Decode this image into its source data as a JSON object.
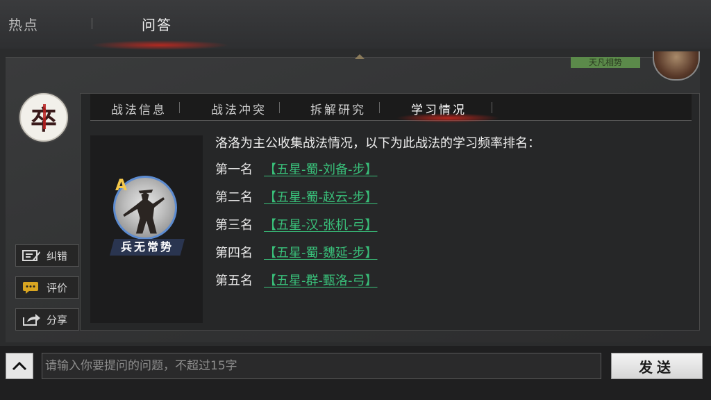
{
  "top_tabs": [
    "热点",
    "问答"
  ],
  "user": {
    "badge": "天凡相势"
  },
  "bot": {
    "avatar_char": "卒"
  },
  "side_buttons": [
    {
      "label": "纠错",
      "icon": "edit-icon"
    },
    {
      "label": "评价",
      "icon": "comment-icon"
    },
    {
      "label": "分享",
      "icon": "share-icon"
    }
  ],
  "panel": {
    "tabs": [
      {
        "label": "战法信息",
        "active": false
      },
      {
        "label": "战法冲突",
        "active": false
      },
      {
        "label": "拆解研究",
        "active": false
      },
      {
        "label": "学习情况",
        "active": true
      }
    ],
    "skill": {
      "grade": "A",
      "name": "兵无常势",
      "icon": "warrior-icon"
    },
    "intro": "洛洛为主公收集战法情况，以下为此战法的学习频率排名：",
    "ranks": [
      {
        "label": "第一名",
        "link": "【五星-蜀-刘备-步】"
      },
      {
        "label": "第二名",
        "link": "【五星-蜀-赵云-步】"
      },
      {
        "label": "第三名",
        "link": "【五星-汉-张机-弓】"
      },
      {
        "label": "第四名",
        "link": "【五星-蜀-魏延-步】"
      },
      {
        "label": "第五名",
        "link": "【五星-群-甄洛-弓】"
      }
    ]
  },
  "input": {
    "placeholder": "请输入你要提问的问题，不超过15字"
  },
  "send_label": "发送",
  "colors": {
    "link": "#39c07a",
    "accent_red": "#c8281e",
    "grade": "#f5c84a"
  }
}
